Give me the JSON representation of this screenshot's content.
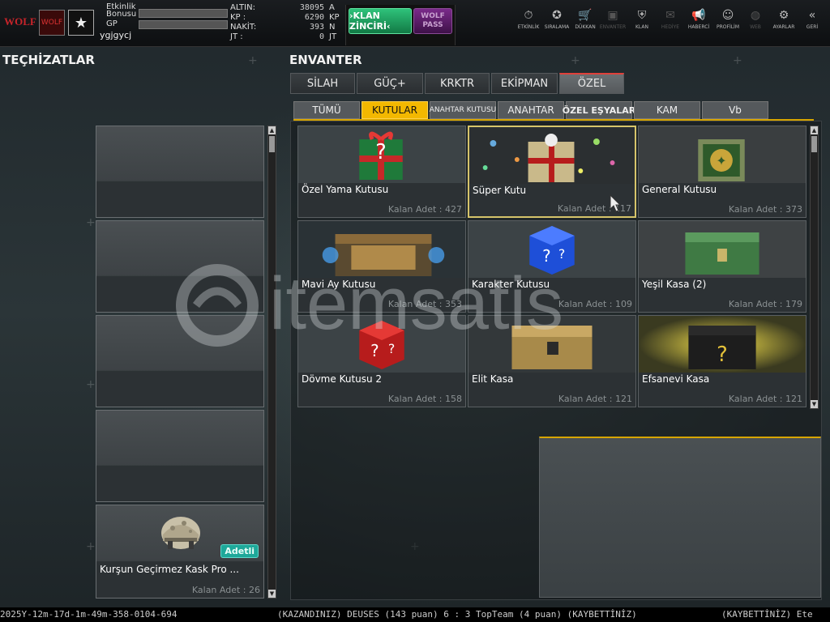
{
  "header": {
    "logo_text": "WOLF",
    "rank_text": "WOLF",
    "bonus_label": "Etkinlik Bonusu",
    "gp_label": "GP",
    "bonus_progress": 0.0,
    "gp_progress": 0.0,
    "username": "ygjgycj",
    "currencies": [
      {
        "label": "ALTIN:",
        "value": "38095",
        "unit": "A"
      },
      {
        "label": "KP :",
        "value": "6290",
        "unit": "KP"
      },
      {
        "label": "NAKİT:",
        "value": "393",
        "unit": "N"
      },
      {
        "label": "JT :",
        "value": "0",
        "unit": "JT"
      }
    ],
    "klan_button": "›KLAN ZİNCİRİ‹",
    "wolf_pass": "WOLF PASS"
  },
  "nav": [
    {
      "label": "ETKİNLİK",
      "icon": "stopwatch-icon",
      "glyph": "⏱"
    },
    {
      "label": "SIRALAMA",
      "icon": "medal-icon",
      "glyph": "✪"
    },
    {
      "label": "DÜKKAN",
      "icon": "cart-icon",
      "glyph": "🛒"
    },
    {
      "label": "ENVANTER",
      "icon": "inventory-icon",
      "glyph": "▣"
    },
    {
      "label": "KLAN",
      "icon": "shield-icon",
      "glyph": "⛨"
    },
    {
      "label": "HEDİYE",
      "icon": "gift-icon",
      "glyph": "✉"
    },
    {
      "label": "HABERCİ",
      "icon": "megaphone-icon",
      "glyph": "📢"
    },
    {
      "label": "PROFİLİM",
      "icon": "profile-icon",
      "glyph": "☺"
    },
    {
      "label": "WEB",
      "icon": "globe-icon",
      "glyph": "◍"
    },
    {
      "label": "AYARLAR",
      "icon": "gear-icon",
      "glyph": "⚙"
    },
    {
      "label": "GERİ",
      "icon": "back-icon",
      "glyph": "«"
    }
  ],
  "left_title": "TEÇHİZATLAR",
  "right_title": "ENVANTER",
  "tabs": [
    "SİLAH",
    "GÜÇ+",
    "KRKTR",
    "EKİPMAN",
    "ÖZEL"
  ],
  "subtabs": [
    "TÜMÜ",
    "KUTULAR",
    "ANAHTAR KUTUSU",
    "ANAHTAR",
    "ÖZEL EŞYALAR",
    "KAM",
    "Vb"
  ],
  "equipment": [
    {
      "name": "",
      "count": ""
    },
    {
      "name": "",
      "count": ""
    },
    {
      "name": "",
      "count": ""
    },
    {
      "name": "",
      "count": ""
    },
    {
      "name": "Kurşun Geçirmez Kask Pro ...",
      "count": "Kalan Adet : 26",
      "badge": "Adetli"
    }
  ],
  "items": [
    {
      "name": "Özel Yama Kutusu",
      "count": "Kalan Adet : 427"
    },
    {
      "name": "Süper Kutu",
      "count": "Kalan Adet : 117"
    },
    {
      "name": "General Kutusu",
      "count": "Kalan Adet : 373"
    },
    {
      "name": "Mavi Ay Kutusu",
      "count": "Kalan Adet : 353"
    },
    {
      "name": "Karakter Kutusu",
      "count": "Kalan Adet : 109"
    },
    {
      "name": "Yeşil Kasa (2)",
      "count": "Kalan Adet : 179"
    },
    {
      "name": "Dövme Kutusu 2",
      "count": "Kalan Adet : 158"
    },
    {
      "name": "Elit Kasa",
      "count": "Kalan Adet : 121"
    },
    {
      "name": "Efsanevi Kasa",
      "count": "Kalan Adet : 121"
    }
  ],
  "watermark": "itemsatis",
  "ticker": {
    "part1": "2025Y-12m-17d-1m-49m-358-0104-694",
    "part2": "(KAZANDINIZ) DEUSES (143 puan) 6 : 3 TopTeam (4 puan) (KAYBETTİNİZ)",
    "part3": "(KAYBETTİNİZ) Ete"
  },
  "colors": {
    "accent": "#f3b800",
    "tab_active_line": "#e0403a",
    "klan_green": "#2ec27a",
    "wolf_purple": "#7a2a8a"
  }
}
